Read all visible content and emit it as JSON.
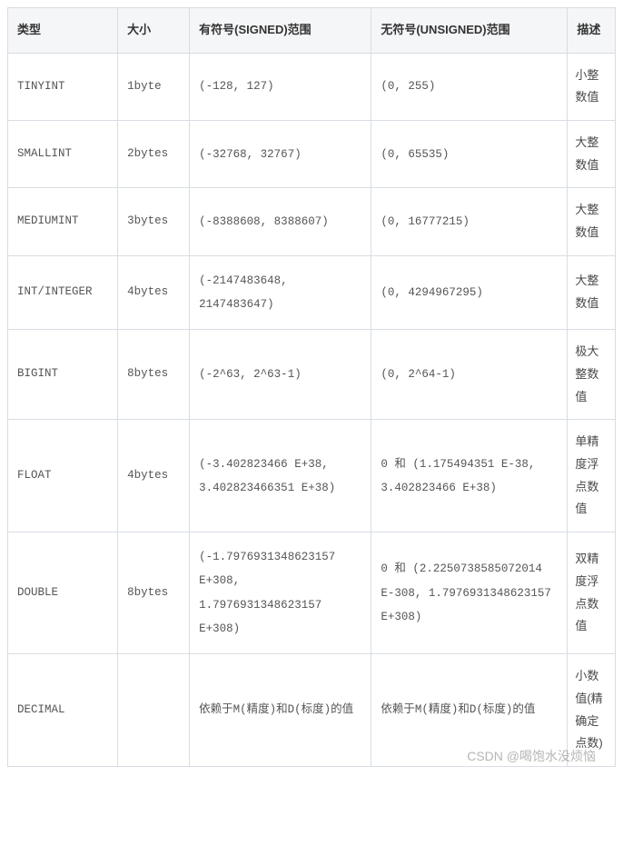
{
  "table": {
    "headers": {
      "type": "类型",
      "size": "大小",
      "signed": "有符号(SIGNED)范围",
      "unsigned": "无符号(UNSIGNED)范围",
      "desc": "描述"
    },
    "rows": [
      {
        "type": "TINYINT",
        "size": "1byte",
        "signed": "(-128, 127)",
        "unsigned": "(0, 255)",
        "desc": "小整数值"
      },
      {
        "type": "SMALLINT",
        "size": "2bytes",
        "signed": "(-32768, 32767)",
        "unsigned": "(0, 65535)",
        "desc": "大整数值"
      },
      {
        "type": "MEDIUMINT",
        "size": "3bytes",
        "signed": "(-8388608, 8388607)",
        "unsigned": "(0, 16777215)",
        "desc": "大整数值"
      },
      {
        "type": "INT/INTEGER",
        "size": "4bytes",
        "signed": "(-2147483648, 2147483647)",
        "unsigned": "(0, 4294967295)",
        "desc": "大整数值"
      },
      {
        "type": "BIGINT",
        "size": "8bytes",
        "signed": "(-2^63, 2^63-1)",
        "unsigned": "(0, 2^64-1)",
        "desc": "极大整数值"
      },
      {
        "type": "FLOAT",
        "size": "4bytes",
        "signed": "(-3.402823466 E+38, 3.402823466351 E+38)",
        "unsigned": "0 和 (1.175494351 E-38, 3.402823466 E+38)",
        "desc": "单精度浮点数值"
      },
      {
        "type": "DOUBLE",
        "size": "8bytes",
        "signed": "(-1.7976931348623157 E+308, 1.7976931348623157 E+308)",
        "unsigned": "0 和 (2.2250738585072014 E-308, 1.7976931348623157 E+308)",
        "desc": "双精度浮点数值"
      },
      {
        "type": "DECIMAL",
        "size": "",
        "signed": "依赖于M(精度)和D(标度)的值",
        "unsigned": "依赖于M(精度)和D(标度)的值",
        "desc": "小数值(精确定点数)"
      }
    ]
  },
  "watermark": "CSDN @喝饱水没烦恼"
}
